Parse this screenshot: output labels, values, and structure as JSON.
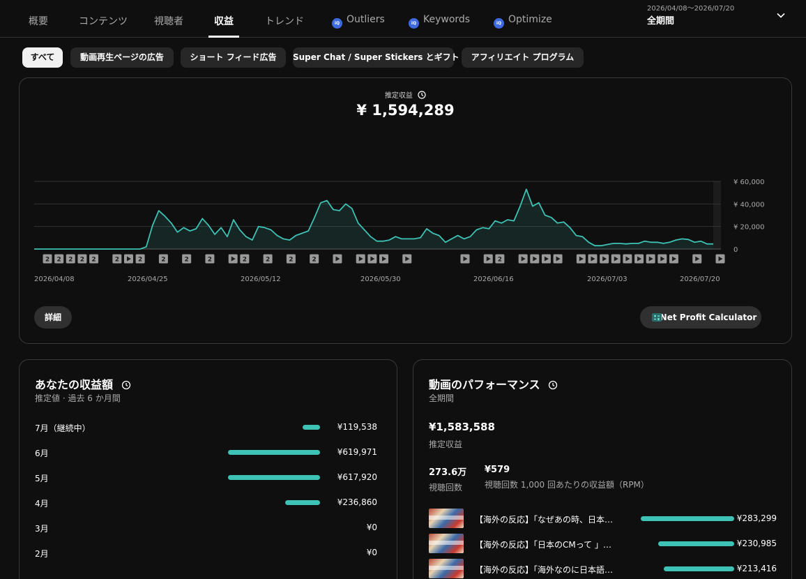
{
  "tabs": [
    {
      "label": "概要",
      "active": false,
      "icon": ""
    },
    {
      "label": "コンテンツ",
      "active": false,
      "icon": ""
    },
    {
      "label": "視聴者",
      "active": false,
      "icon": ""
    },
    {
      "label": "収益",
      "active": true,
      "icon": ""
    },
    {
      "label": "トレンド",
      "active": false,
      "icon": ""
    },
    {
      "label": "Outliers",
      "active": false,
      "icon": "vidiq-icon"
    },
    {
      "label": "Keywords",
      "active": false,
      "icon": "vidiq-icon"
    },
    {
      "label": "Optimize",
      "active": false,
      "icon": "vidiq-icon"
    }
  ],
  "vidiq_icon_text": "iQ",
  "period": {
    "range": "2026/04/08〜2026/07/20",
    "label": "全期間"
  },
  "chips": [
    {
      "label": "すべて",
      "active": true
    },
    {
      "label": "動画再生ページの広告",
      "active": false
    },
    {
      "label": "ショート フィード広告",
      "active": false
    },
    {
      "label": "Super Chat / Super Stickers とギフト",
      "active": false
    },
    {
      "label": "アフィリエイト プログラム",
      "active": false
    }
  ],
  "summary": {
    "label": "推定収益",
    "total": "¥ 1,594,289"
  },
  "chart_data": {
    "type": "area",
    "y_tick_labels": [
      "¥ 60,000",
      "¥ 40,000",
      "¥ 20,000",
      "0"
    ],
    "ylim": [
      0,
      60000
    ],
    "x_tick_labels": [
      "2026/04/08",
      "2026/04/25",
      "2026/05/12",
      "2026/05/30",
      "2026/06/16",
      "2026/07/03",
      "2026/07/20"
    ],
    "grid": true,
    "color": "#3ec2b5",
    "y_values": [
      0,
      0,
      0,
      0,
      0,
      0,
      0,
      0,
      0,
      0,
      0,
      0,
      0,
      0,
      0,
      0,
      0,
      0,
      2000,
      21000,
      34000,
      29000,
      23000,
      15000,
      19000,
      16000,
      18000,
      27000,
      21000,
      13000,
      19000,
      11000,
      26000,
      17000,
      11000,
      8000,
      20000,
      19000,
      17000,
      12000,
      9000,
      8000,
      12000,
      14000,
      16000,
      28000,
      41000,
      43000,
      35000,
      34000,
      40000,
      36000,
      23000,
      17000,
      11000,
      7000,
      7000,
      8000,
      11000,
      9000,
      9000,
      9000,
      10000,
      18000,
      14000,
      12000,
      6000,
      9000,
      12000,
      9000,
      11000,
      17000,
      19000,
      18000,
      25000,
      23000,
      26000,
      25000,
      38000,
      53000,
      38000,
      41000,
      30000,
      28000,
      23000,
      24000,
      19000,
      12000,
      11000,
      6000,
      3000,
      3000,
      4000,
      5000,
      5000,
      4500,
      5000,
      5000,
      7000,
      6000,
      6000,
      5000,
      6000,
      8000,
      9000,
      8500,
      6000,
      7000,
      4500,
      4500
    ],
    "markers": [
      "2",
      "2",
      "2",
      "2",
      "2",
      "",
      "2",
      "play",
      "2",
      "",
      "2",
      "",
      "2",
      "",
      "2",
      "",
      "play",
      "2",
      "",
      "2",
      "",
      "2",
      "",
      "2",
      "",
      "play",
      "",
      "play",
      "play",
      "play",
      "",
      "play",
      "",
      "",
      "",
      "",
      "play",
      "",
      "play",
      "2",
      "",
      "play",
      "play",
      "play",
      "play",
      "",
      "play",
      "play",
      "play",
      "play",
      "play",
      "play",
      "play",
      "play",
      "play",
      "",
      "play",
      "",
      "play"
    ]
  },
  "buttons": {
    "detail": "詳細",
    "npc": "Net Profit Calculator"
  },
  "revenue": {
    "title": "あなたの収益額",
    "subtitle": "推定値 · 過去 6 か月間",
    "max_value": 619971,
    "rows": [
      {
        "month": "7月（継続中）",
        "value_text": "¥119,538",
        "value": 119538
      },
      {
        "month": "6月",
        "value_text": "¥619,971",
        "value": 619971
      },
      {
        "month": "5月",
        "value_text": "¥617,920",
        "value": 617920
      },
      {
        "month": "4月",
        "value_text": "¥236,860",
        "value": 236860
      },
      {
        "month": "3月",
        "value_text": "¥0",
        "value": 0
      },
      {
        "month": "2月",
        "value_text": "¥0",
        "value": 0
      }
    ]
  },
  "performance": {
    "title": "動画のパフォーマンス",
    "subtitle": "全期間",
    "revenue_value": "¥1,583,588",
    "revenue_label": "推定収益",
    "views_value": "273.6万",
    "views_label": "視聴回数",
    "rpm_value": "¥579",
    "rpm_label": "視聴回数 1,000 回あたりの収益額（RPM）",
    "max_value": 283299,
    "videos": [
      {
        "title": "【海外の反応】「なぜあの時、日本…",
        "value_text": "¥283,299",
        "value": 283299
      },
      {
        "title": "【海外の反応】「日本のCMって 」…",
        "value_text": "¥230,985",
        "value": 230985
      },
      {
        "title": "【海外の反応】「海外なのに日本語…",
        "value_text": "¥213,416",
        "value": 213416
      }
    ]
  }
}
